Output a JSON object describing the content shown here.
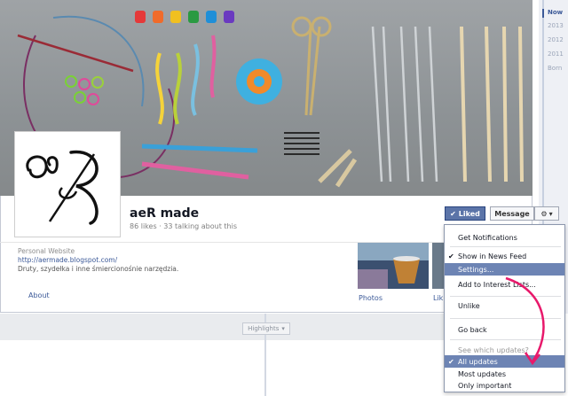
{
  "timeline": {
    "years": [
      "Now",
      "2013",
      "2012",
      "2011",
      "Born"
    ]
  },
  "page": {
    "name": "aeR made",
    "stats": "86 likes · 33 talking about this"
  },
  "buttons": {
    "liked": "Liked",
    "message": "Message",
    "gear": "⚙"
  },
  "info": {
    "label": "Personal Website",
    "url": "http://aermade.blogspot.com/",
    "description": "Druty, szydełka i inne śmiercionośnie narzędzia."
  },
  "tabs": {
    "about": "About",
    "photos": "Photos",
    "likes": "Lik"
  },
  "highlights": {
    "label": "Highlights"
  },
  "menu": {
    "items": [
      {
        "label": "Get Notifications",
        "checked": false,
        "selected": false
      },
      {
        "label": "Show in News Feed",
        "checked": true,
        "selected": false
      },
      {
        "label": "Settings...",
        "checked": false,
        "selected": true
      },
      {
        "label": "Add to Interest Lists...",
        "checked": false,
        "selected": false
      },
      {
        "label": "Unlike",
        "checked": false,
        "selected": false
      },
      {
        "label": "Go back",
        "checked": false,
        "selected": false
      },
      {
        "label": "See which updates?",
        "checked": false,
        "selected": false,
        "muted": true
      },
      {
        "label": "All updates",
        "checked": true,
        "selected": true
      },
      {
        "label": "Most updates",
        "checked": false,
        "selected": false
      },
      {
        "label": "Only important",
        "checked": false,
        "selected": false
      }
    ]
  },
  "colors": {
    "accent": "#3b5998",
    "liked": "#5b74a8",
    "arrow": "#e8196b"
  }
}
